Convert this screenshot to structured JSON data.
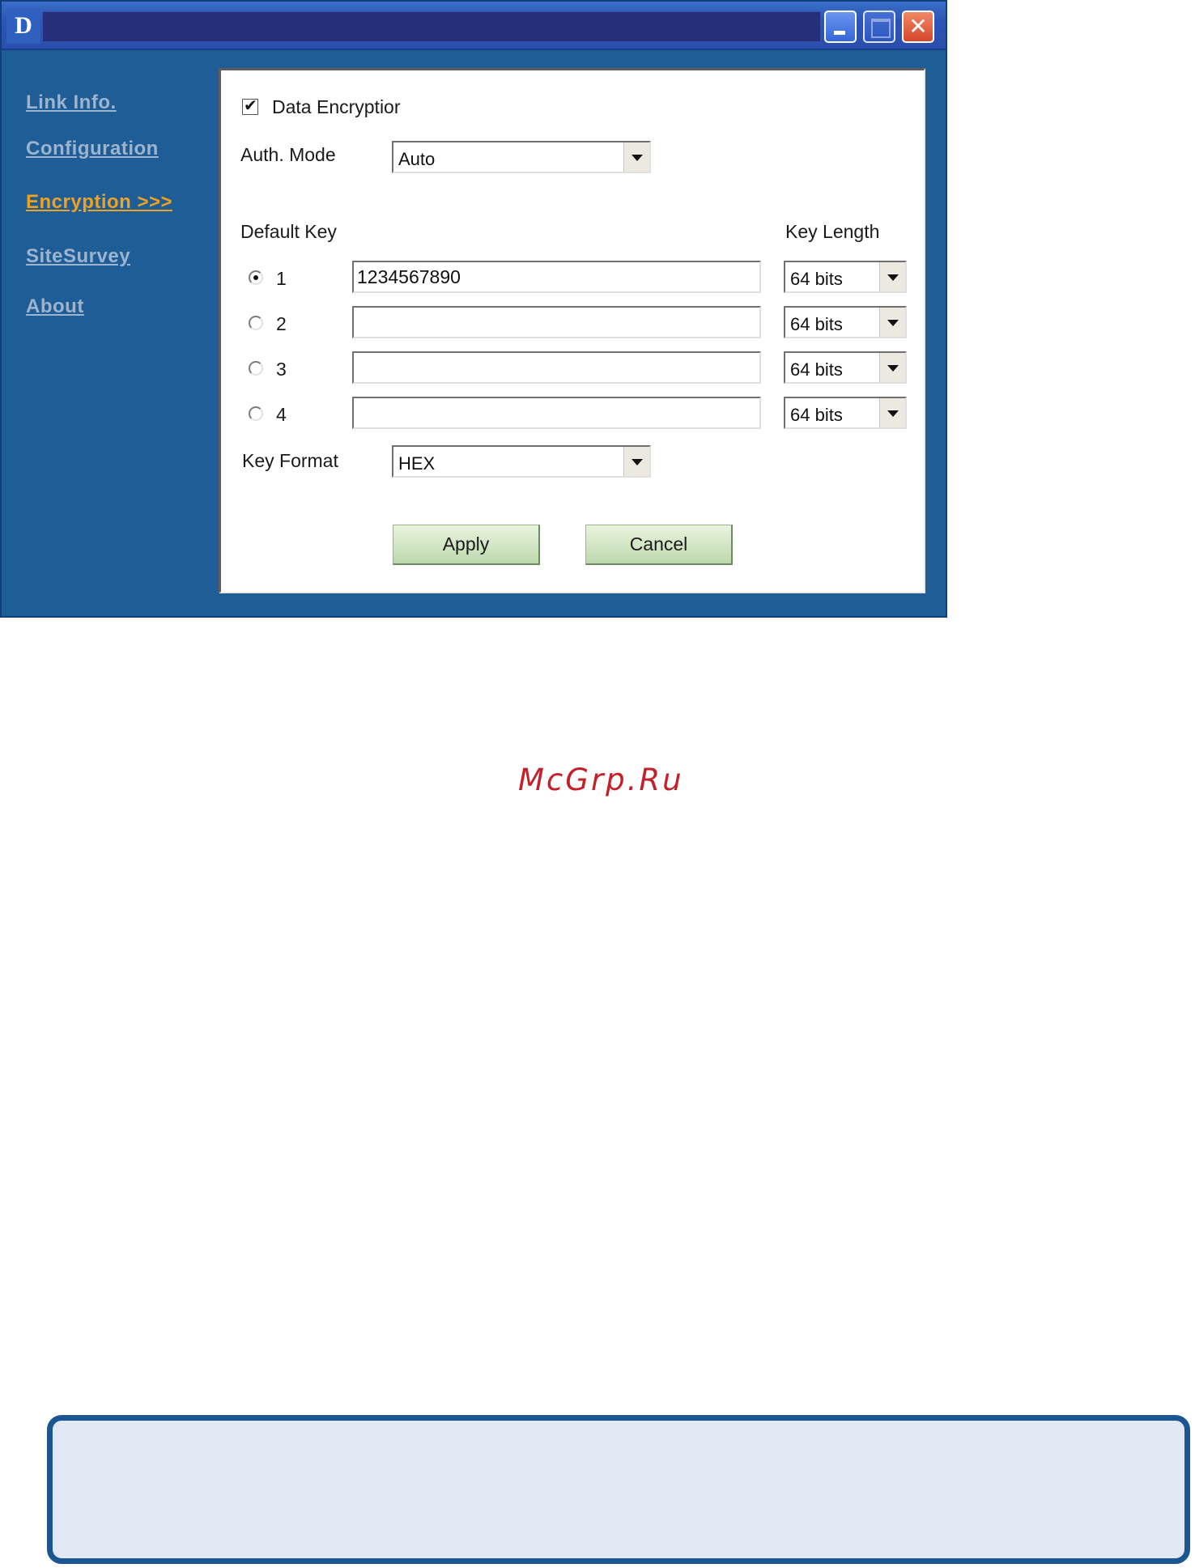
{
  "window": {
    "logo_letter": "D",
    "close_glyph": "✕"
  },
  "sidebar": {
    "items": [
      {
        "label": "Link Info.",
        "active": false
      },
      {
        "label": "Configuration",
        "active": false
      },
      {
        "label": "Encryption >>>",
        "active": true
      },
      {
        "label": "SiteSurvey",
        "active": false
      },
      {
        "label": "About",
        "active": false
      }
    ]
  },
  "encryption": {
    "data_encryption_label": "Data Encryptior",
    "data_encryption_checked": true,
    "auth_mode_label": "Auth. Mode",
    "auth_mode_value": "Auto",
    "default_key_label": "Default Key",
    "key_length_label": "Key Length",
    "keys": [
      {
        "number": "1",
        "value": "1234567890",
        "length": "64 bits",
        "selected": true
      },
      {
        "number": "2",
        "value": "",
        "length": "64 bits",
        "selected": false
      },
      {
        "number": "3",
        "value": "",
        "length": "64 bits",
        "selected": false
      },
      {
        "number": "4",
        "value": "",
        "length": "64 bits",
        "selected": false
      }
    ],
    "key_format_label": "Key Format",
    "key_format_value": "HEX",
    "apply_label": "Apply",
    "cancel_label": "Cancel"
  },
  "watermark": "McGrp.Ru",
  "colors": {
    "window_bg": "#1f5d97",
    "active_nav": "#f0a11e",
    "nav": "#9cb4cd",
    "watermark": "#c3202a",
    "note_border": "#1b5592"
  }
}
